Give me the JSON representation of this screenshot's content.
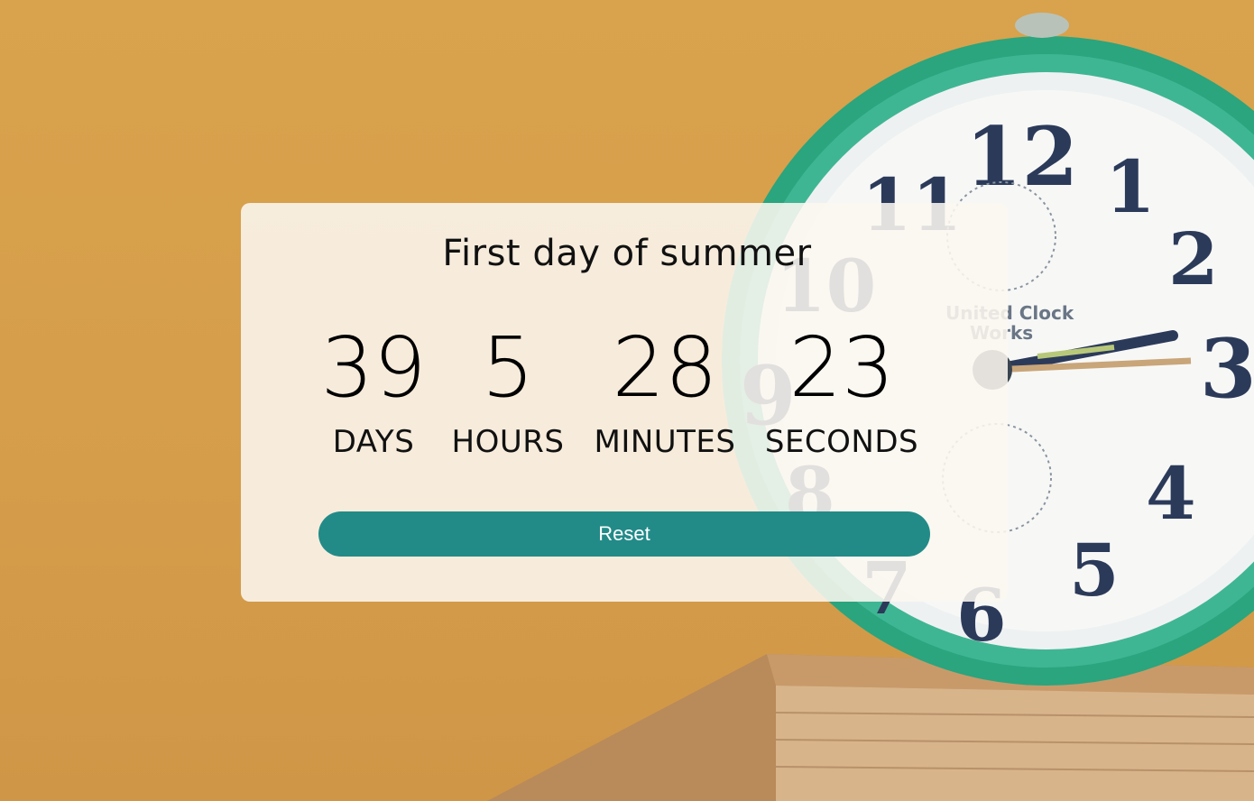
{
  "countdown": {
    "title": "First day of summer",
    "units": [
      {
        "value": "39",
        "label": "DAYS"
      },
      {
        "value": "5",
        "label": "HOURS"
      },
      {
        "value": "28",
        "label": "MINUTES"
      },
      {
        "value": "23",
        "label": "SECONDS"
      }
    ],
    "reset_label": "Reset"
  },
  "background": {
    "image": "alarm-clock-photo",
    "clock_numerals": [
      "12",
      "1",
      "2",
      "3",
      "4",
      "5",
      "6",
      "7",
      "8",
      "9",
      "10",
      "11"
    ],
    "clock_brand": [
      "United Clock",
      "Works"
    ]
  },
  "colors": {
    "accent": "#228b88",
    "background": "#d9a24c",
    "card": "#fcf7f0"
  }
}
